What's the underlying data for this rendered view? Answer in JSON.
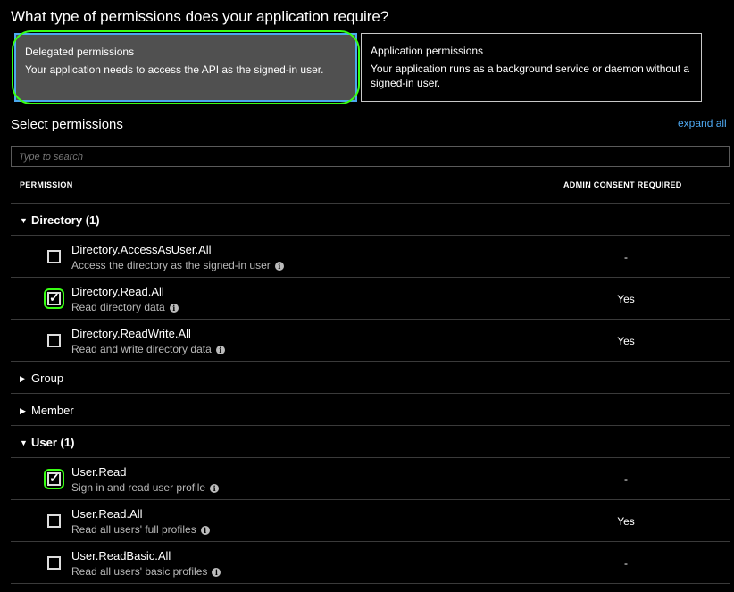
{
  "question": "What type of permissions does your application require?",
  "permission_types": [
    {
      "title": "Delegated permissions",
      "desc": "Your application needs to access the API as the signed-in user."
    },
    {
      "title": "Application permissions",
      "desc": "Your application runs as a background service or daemon without a signed-in user."
    }
  ],
  "select_title": "Select permissions",
  "expand_all": "expand all",
  "search": {
    "placeholder": "Type to search",
    "value": ""
  },
  "columns": {
    "permission": "PERMISSION",
    "admin_consent": "ADMIN CONSENT REQUIRED"
  },
  "groups": [
    {
      "label": "Directory (1)",
      "expanded": true
    },
    {
      "label": "Group",
      "expanded": false
    },
    {
      "label": "Member",
      "expanded": false
    },
    {
      "label": "User (1)",
      "expanded": true
    }
  ],
  "permissions": [
    {
      "name": "Directory.AccessAsUser.All",
      "desc": "Access the directory as the signed-in user",
      "admin": "-",
      "checked": false
    },
    {
      "name": "Directory.Read.All",
      "desc": "Read directory data",
      "admin": "Yes",
      "checked": true
    },
    {
      "name": "Directory.ReadWrite.All",
      "desc": "Read and write directory data",
      "admin": "Yes",
      "checked": false
    },
    {
      "name": "User.Read",
      "desc": "Sign in and read user profile",
      "admin": "-",
      "checked": true
    },
    {
      "name": "User.Read.All",
      "desc": "Read all users' full profiles",
      "admin": "Yes",
      "checked": false
    },
    {
      "name": "User.ReadBasic.All",
      "desc": "Read all users' basic profiles",
      "admin": "-",
      "checked": false
    }
  ],
  "icons": {
    "expanded": "caret-down-icon",
    "collapsed": "caret-right-icon",
    "info": "info-icon"
  },
  "colors": {
    "accent": "#4ea8f0",
    "highlight": "#39ff14",
    "selected_card": "#505050"
  }
}
